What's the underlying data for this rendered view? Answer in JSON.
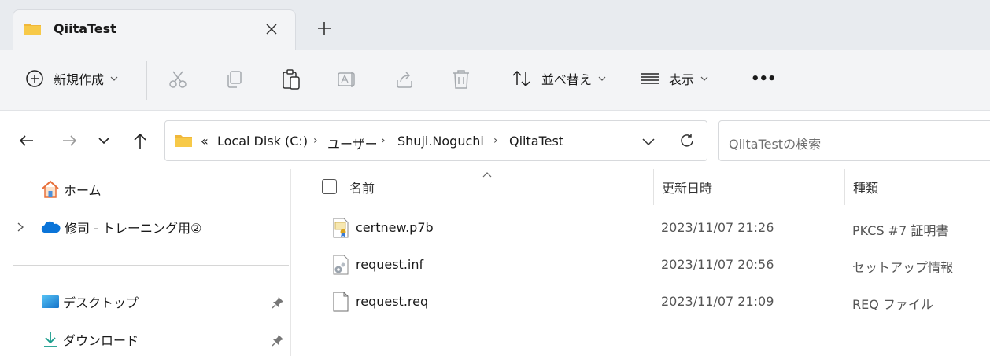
{
  "tab": {
    "title": "QiitaTest"
  },
  "toolbar": {
    "new_label": "新規作成",
    "sort_label": "並べ替え",
    "view_label": "表示",
    "more_label": "•••"
  },
  "address": {
    "overflow": "«",
    "crumbs": [
      "Local Disk (C:)",
      "ユーザー",
      "Shuji.Noguchi",
      "QiitaTest"
    ],
    "search_placeholder": "QiitaTestの検索"
  },
  "sidebar": {
    "items": [
      {
        "label": "ホーム",
        "icon": "home-icon"
      },
      {
        "label": "修司 - トレーニング用②",
        "icon": "onedrive-icon"
      },
      {
        "label": "デスクトップ",
        "icon": "desktop-icon"
      },
      {
        "label": "ダウンロード",
        "icon": "download-icon"
      }
    ]
  },
  "columns": {
    "name": "名前",
    "modified": "更新日時",
    "type": "種類"
  },
  "files": [
    {
      "name": "certnew.p7b",
      "modified": "2023/11/07 21:26",
      "type": "PKCS #7 証明書",
      "icon": "certificate-file-icon"
    },
    {
      "name": "request.inf",
      "modified": "2023/11/07 20:56",
      "type": "セットアップ情報",
      "icon": "setup-info-file-icon"
    },
    {
      "name": "request.req",
      "modified": "2023/11/07 21:09",
      "type": "REQ ファイル",
      "icon": "generic-file-icon"
    }
  ],
  "colors": {
    "folder": "#f7c948",
    "accent": "#0067c0",
    "onedrive": "#0a74d8"
  }
}
